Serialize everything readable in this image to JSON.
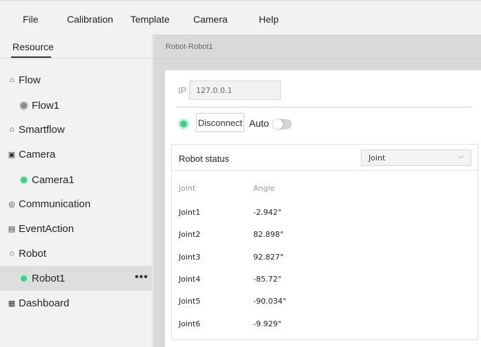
{
  "menu": [
    "File",
    "Calibration",
    "Template",
    "Camera",
    "Help"
  ],
  "sidebar": {
    "tab": "Resource",
    "items": [
      {
        "label": "Flow",
        "icon": "bell-icon"
      },
      {
        "label": "Flow1",
        "status": "gray"
      },
      {
        "label": "Smartflow",
        "icon": "bell-icon"
      },
      {
        "label": "Camera",
        "icon": "camera-icon"
      },
      {
        "label": "Camera1",
        "status": "green"
      },
      {
        "label": "Communication",
        "icon": "communication-icon"
      },
      {
        "label": "EventAction",
        "icon": "document-icon"
      },
      {
        "label": "Robot",
        "icon": "robot-icon"
      },
      {
        "label": "Robot1",
        "status": "green",
        "selected": true
      },
      {
        "label": "Dashboard",
        "icon": "dashboard-icon"
      }
    ]
  },
  "main": {
    "breadcrumb": "Robot-Robot1",
    "ip_label": "IP",
    "ip_value": "127.0.0.1",
    "disconnect_label": "Disconnect",
    "auto_label": "Auto",
    "auto_enabled": false,
    "status": {
      "title": "Robot status",
      "mode": "Joint",
      "columns": [
        "Joint",
        "Angle"
      ],
      "rows": [
        {
          "joint": "Joint1",
          "angle": "-2.942°"
        },
        {
          "joint": "Joint2",
          "angle": "82.898°"
        },
        {
          "joint": "Joint3",
          "angle": "92.827°"
        },
        {
          "joint": "Joint4",
          "angle": "-85.72°"
        },
        {
          "joint": "Joint5",
          "angle": "-90.034°"
        },
        {
          "joint": "Joint6",
          "angle": "-9.929°"
        }
      ]
    }
  },
  "colors": {
    "connected": "#3dcf88",
    "idle": "#888888"
  }
}
